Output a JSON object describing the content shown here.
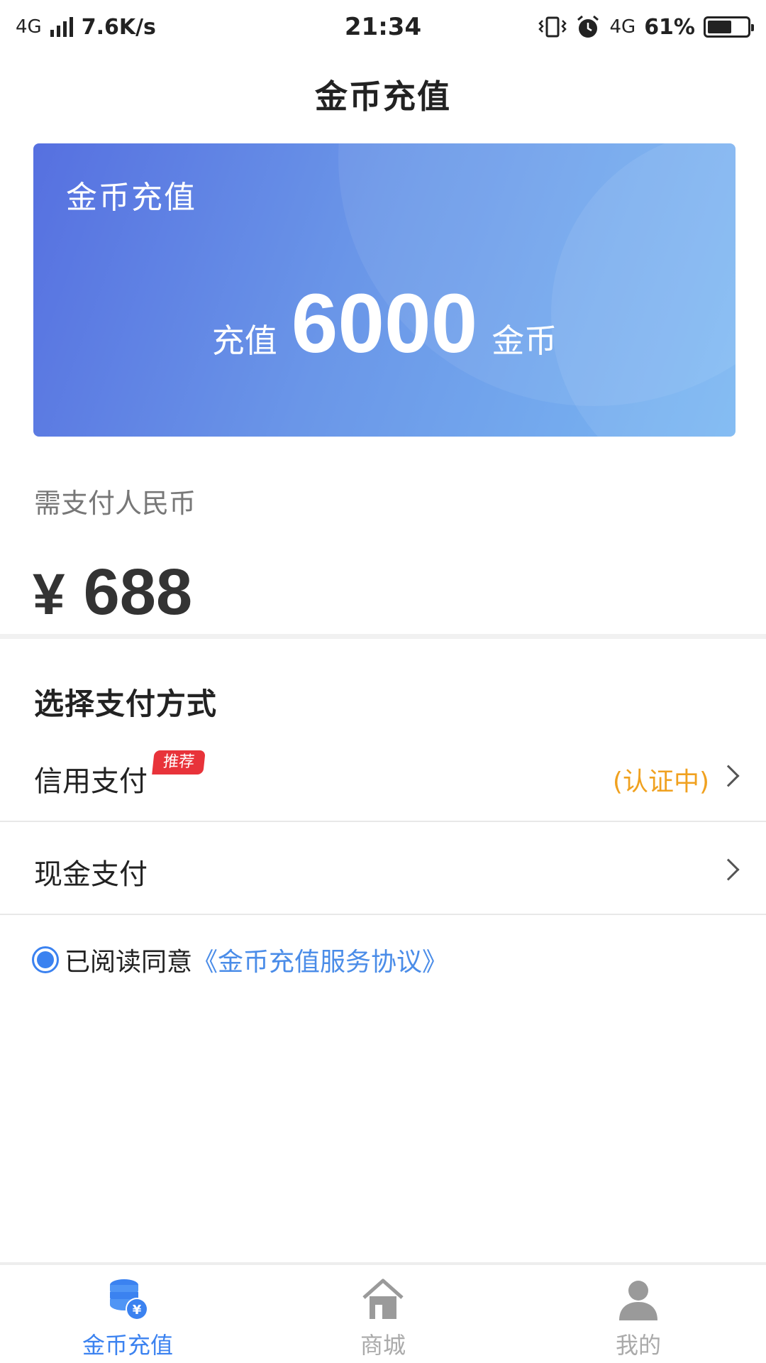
{
  "status_bar": {
    "network": "4G",
    "speed": "7.6K/s",
    "time": "21:34",
    "network_right": "4G",
    "battery": "61%"
  },
  "page_title": "金币充值",
  "banner": {
    "label": "金币充值",
    "prefix": "充值",
    "amount": "6000",
    "suffix": "金币"
  },
  "payment": {
    "label": "需支付人民币",
    "currency": "¥",
    "amount": "688"
  },
  "methods": {
    "title": "选择支付方式",
    "credit": {
      "name": "信用支付",
      "badge": "推荐",
      "status": "(认证中)"
    },
    "cash": {
      "name": "现金支付"
    }
  },
  "agreement": {
    "checked": true,
    "text": "已阅读同意",
    "link": "《金币充值服务协议》"
  },
  "bottom_nav": {
    "items": [
      {
        "label": "金币充值",
        "icon": "coin-stack-icon",
        "active": true
      },
      {
        "label": "商城",
        "icon": "home-store-icon",
        "active": false
      },
      {
        "label": "我的",
        "icon": "profile-icon",
        "active": false
      }
    ]
  },
  "colors": {
    "accent": "#3b82f0",
    "link": "#4a8ce8",
    "status_pending": "#f0a11f",
    "badge": "#e8333a",
    "banner_start": "#5670e0",
    "banner_end": "#7bb8f2"
  }
}
